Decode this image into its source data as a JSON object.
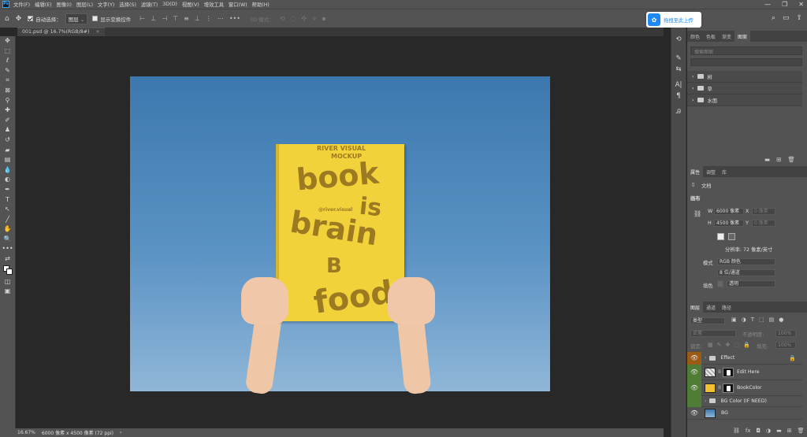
{
  "app": {
    "logo": "Ps"
  },
  "menu": [
    "文件(F)",
    "编辑(E)",
    "图像(I)",
    "图层(L)",
    "文字(Y)",
    "选择(S)",
    "滤镜(T)",
    "3D(D)",
    "视图(V)",
    "增效工具",
    "窗口(W)",
    "帮助(H)"
  ],
  "options": {
    "auto_select_label": "自动选择：",
    "auto_select_target": "图层",
    "show_transform_label": "显示变换控件",
    "mode_3d_label": "3D 模式："
  },
  "upload_badge": {
    "label": "拖拽至此上传"
  },
  "document_tab": {
    "label": "001.psd @ 16.7%(RGB/8#)",
    "close": "×"
  },
  "mockup": {
    "brand_line1": "RIVER VISUAL",
    "brand_line2": "MOCKUP",
    "word_book": "book",
    "word_is": "is",
    "word_brain": "brain",
    "logo_glyph": "B",
    "handle": "@river.visual",
    "word_food": "food"
  },
  "status": {
    "zoom": "16.67%",
    "doc_info": "6000 像素 x 4500 像素 (72 ppi)"
  },
  "libraries_panel": {
    "tabs": [
      "颜色",
      "色板",
      "渐变",
      "图案"
    ],
    "search_placeholder": "搜索图案",
    "groups": [
      "树",
      "草",
      "水面"
    ]
  },
  "properties_panel": {
    "tabs": [
      "属性",
      "调整",
      "库"
    ],
    "section_label": "文档",
    "canvas_title": "画布",
    "width_label": "W",
    "width_value": "6000 像素",
    "height_label": "H",
    "height_value": "4500 像素",
    "x_label": "X",
    "x_value": "0 像素",
    "y_label": "Y",
    "y_value": "0 像素",
    "resolution": "分辨率: 72 像素/英寸",
    "mode_label": "模式",
    "mode_value": "RGB 颜色",
    "depth_value": "8 位/通道",
    "fill_label": "填色",
    "fill_value": "透明"
  },
  "layers_panel": {
    "tabs": [
      "图层",
      "通道",
      "路径"
    ],
    "filter_kind": "类型",
    "blend_mode": "正常",
    "opacity_label": "不透明度:",
    "opacity_value": "100%",
    "lock_label": "锁定:",
    "fill_label": "填充:",
    "fill_value": "100%",
    "layers": [
      {
        "name": "Effect",
        "kind": "group",
        "locked": true,
        "color": "#9c5b14"
      },
      {
        "name": "Edit Here",
        "kind": "smart",
        "color": "#4f7d35"
      },
      {
        "name": "BookColor",
        "kind": "fill",
        "color": "#4f7d35"
      },
      {
        "name": "BG Color (IF NEED)",
        "kind": "group",
        "color": "#4f7d35"
      },
      {
        "name": "BG",
        "kind": "image",
        "color": "#535353"
      }
    ]
  }
}
